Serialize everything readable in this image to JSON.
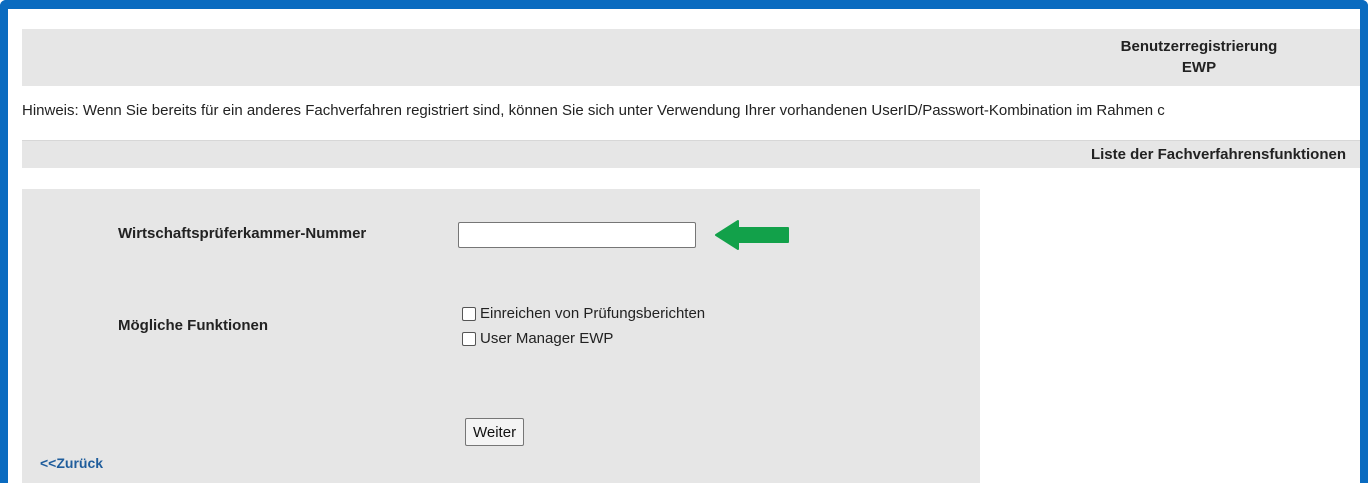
{
  "header": {
    "title_line1": "Benutzerregistrierung",
    "title_line2": "EWP"
  },
  "hint": "Hinweis: Wenn Sie bereits für ein anderes Fachverfahren registriert sind, können Sie sich unter Verwendung Ihrer vorhandenen UserID/Passwort-Kombination im Rahmen c",
  "section": {
    "title": "Liste der Fachverfahrensfunktionen"
  },
  "form": {
    "wpk_label": "Wirtschaftsprüferkammer-Nummer",
    "wpk_value": "",
    "functions_label": "Mögliche Funktionen",
    "functions": [
      {
        "label": "Einreichen von Prüfungsberichten",
        "checked": false
      },
      {
        "label": "User Manager EWP",
        "checked": false
      }
    ],
    "submit_label": "Weiter"
  },
  "back_link": "<<Zurück",
  "colors": {
    "frame": "#0a6bc0",
    "panel": "#e6e6e6",
    "arrow": "#12a14a",
    "link": "#1f5d9c"
  }
}
